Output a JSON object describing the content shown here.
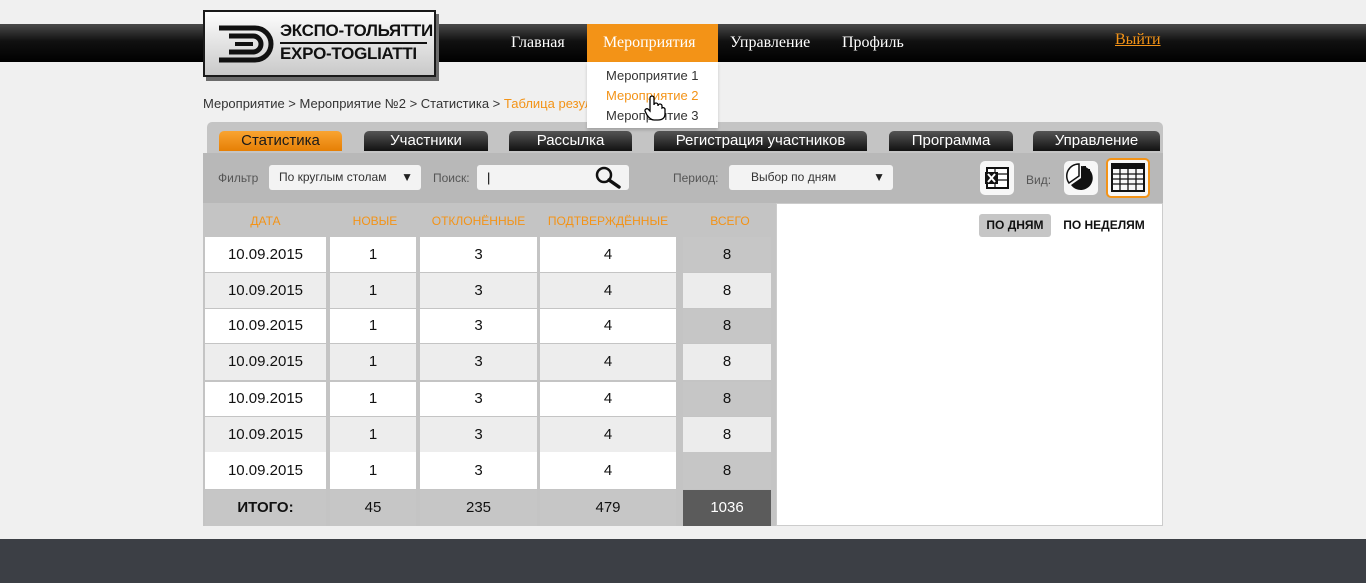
{
  "logo": {
    "line1": "ЭКСПО-ТОЛЬЯТТИ",
    "line2": "EXPO-TOGLIATTI"
  },
  "nav": {
    "items": [
      {
        "label": "Главная",
        "active": false
      },
      {
        "label": "Мероприятия",
        "active": true
      },
      {
        "label": "Управление",
        "active": false
      },
      {
        "label": "Профиль",
        "active": false
      }
    ],
    "logout": "Выйти"
  },
  "dropdown": {
    "items": [
      {
        "label": "Мероприятие 1",
        "highlighted": false
      },
      {
        "label": "Мероприятие 2",
        "highlighted": true
      },
      {
        "label": "Мероприятие 3",
        "highlighted": false
      }
    ]
  },
  "breadcrumb": {
    "path": "Мероприятие > Мероприятие №2 > Статистика > ",
    "current": "Таблица резул"
  },
  "tabs": [
    {
      "label": "Статистика",
      "active": true
    },
    {
      "label": "Участники",
      "active": false
    },
    {
      "label": "Рассылка",
      "active": false
    },
    {
      "label": "Регистрация участников",
      "active": false
    },
    {
      "label": "Программа",
      "active": false
    },
    {
      "label": "Управление",
      "active": false
    }
  ],
  "filter": {
    "filter_label": "Фильтр",
    "filter_value": "По круглым столам",
    "search_label": "Поиск:",
    "search_value": "|",
    "period_label": "Период:",
    "period_value": "Выбор по дням",
    "view_label": "Вид:"
  },
  "table": {
    "headers": [
      "ДАТА",
      "НОВЫЕ",
      "ОТКЛОНЁННЫЕ",
      "ПОДТВЕРЖДЁННЫЕ",
      "ВСЕГО"
    ],
    "rows": [
      [
        "10.09.2015",
        "1",
        "3",
        "4",
        "8"
      ],
      [
        "10.09.2015",
        "1",
        "3",
        "4",
        "8"
      ],
      [
        "10.09.2015",
        "1",
        "3",
        "4",
        "8"
      ],
      [
        "10.09.2015",
        "1",
        "3",
        "4",
        "8"
      ],
      [
        "10.09.2015",
        "1",
        "3",
        "4",
        "8"
      ],
      [
        "10.09.2015",
        "1",
        "3",
        "4",
        "8"
      ],
      [
        "10.09.2015",
        "1",
        "3",
        "4",
        "8"
      ]
    ],
    "totals": [
      "ИТОГО:",
      "45",
      "235",
      "479",
      "1036"
    ]
  },
  "view_toggle": {
    "by_days": "ПО ДНЯМ",
    "by_weeks": "ПО НЕДЕЛЯМ"
  },
  "colors": {
    "accent": "#f39317",
    "dark": "#111111",
    "panel": "#c4c4c4",
    "footer": "#3c3f45"
  },
  "icons": [
    "search-icon",
    "excel-export-icon",
    "chart-view-icon",
    "table-view-icon",
    "dropdown-arrow-icon",
    "hand-cursor-icon"
  ]
}
